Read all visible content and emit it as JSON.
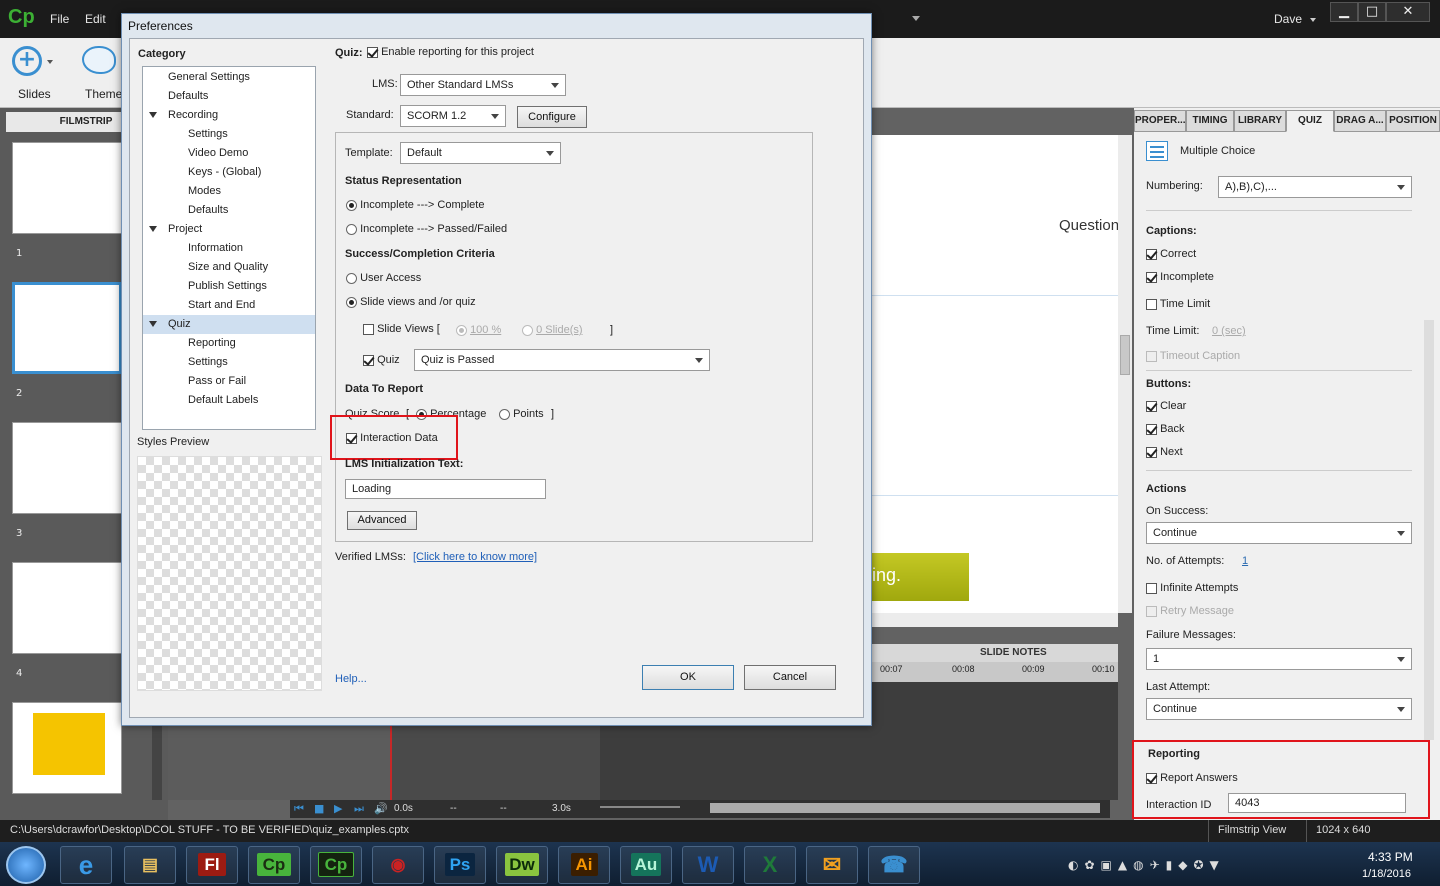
{
  "app": {
    "logo": "Cp",
    "menu": [
      "File",
      "Edit"
    ],
    "user": "Dave",
    "window_buttons": [
      "minimize",
      "maximize",
      "close"
    ]
  },
  "toolbar": {
    "slides_label": "Slides",
    "themes_label": "Themes"
  },
  "filmstrip": {
    "header": "FILMSTRIP",
    "slides": [
      "1",
      "2",
      "3",
      "4"
    ]
  },
  "stage": {
    "question_text": "Question",
    "banner_text": "ing.",
    "slide_notes": "SLIDE NOTES",
    "timeline_ticks": [
      "00:07",
      "00:08",
      "00:09",
      "00:10"
    ],
    "play_time": "0.0s",
    "duration": "3.0s",
    "dash1": "--",
    "dash2": "--"
  },
  "right_panel": {
    "tabs": [
      "PROPER...",
      "TIMING",
      "LIBRARY",
      "QUIZ",
      "DRAG A...",
      "POSITION"
    ],
    "question_type": "Multiple Choice",
    "numbering_label": "Numbering:",
    "numbering_value": "A),B),C),...",
    "captions_head": "Captions:",
    "captions": [
      {
        "label": "Correct",
        "checked": true
      },
      {
        "label": "Incomplete",
        "checked": true
      },
      {
        "label": "Time Limit",
        "checked": false
      }
    ],
    "time_limit_label": "Time Limit:",
    "time_limit_value": "0 (sec)",
    "timeout_caption": "Timeout Caption",
    "buttons_head": "Buttons:",
    "buttons": [
      {
        "label": "Clear",
        "checked": true
      },
      {
        "label": "Back",
        "checked": true
      },
      {
        "label": "Next",
        "checked": true
      }
    ],
    "actions_head": "Actions",
    "on_success_label": "On Success:",
    "on_success_value": "Continue",
    "attempts_label": "No. of Attempts:",
    "attempts_value": "1",
    "infinite_attempts": "Infinite Attempts",
    "retry_message": "Retry Message",
    "failure_messages_label": "Failure Messages:",
    "failure_messages_value": "1",
    "last_attempt_label": "Last Attempt:",
    "last_attempt_value": "Continue",
    "reporting_head": "Reporting",
    "report_answers": "Report Answers",
    "interaction_id_label": "Interaction ID",
    "interaction_id_value": "4043"
  },
  "status": {
    "path": "C:\\Users\\dcrawfor\\Desktop\\DCOL STUFF - TO BE VERIFIED\\quiz_examples.cptx",
    "view": "Filmstrip View",
    "resolution": "1024 x 640"
  },
  "taskbar": {
    "apps": [
      "Fl",
      "Cp",
      "Cp",
      "Ps",
      "Dw",
      "Ai",
      "Au",
      "W",
      "X"
    ],
    "time": "4:33 PM",
    "date": "1/18/2016"
  },
  "dialog": {
    "title": "Preferences",
    "category_head": "Category",
    "tree": [
      {
        "label": "General Settings",
        "level": 1,
        "expander": false
      },
      {
        "label": "Defaults",
        "level": 1,
        "expander": false
      },
      {
        "label": "Recording",
        "level": 1,
        "expander": true
      },
      {
        "label": "Settings",
        "level": 2,
        "expander": false
      },
      {
        "label": "Video Demo",
        "level": 2,
        "expander": false
      },
      {
        "label": "Keys - (Global)",
        "level": 2,
        "expander": false
      },
      {
        "label": "Modes",
        "level": 2,
        "expander": false
      },
      {
        "label": "Defaults",
        "level": 2,
        "expander": false
      },
      {
        "label": "Project",
        "level": 1,
        "expander": true
      },
      {
        "label": "Information",
        "level": 2,
        "expander": false
      },
      {
        "label": "Size and Quality",
        "level": 2,
        "expander": false
      },
      {
        "label": "Publish Settings",
        "level": 2,
        "expander": false
      },
      {
        "label": "Start and End",
        "level": 2,
        "expander": false
      },
      {
        "label": "Quiz",
        "level": 1,
        "expander": true,
        "selected": true
      },
      {
        "label": "Reporting",
        "level": 2,
        "expander": false
      },
      {
        "label": "Settings",
        "level": 2,
        "expander": false
      },
      {
        "label": "Pass or Fail",
        "level": 2,
        "expander": false
      },
      {
        "label": "Default Labels",
        "level": 2,
        "expander": false
      }
    ],
    "styles_preview": "Styles Preview",
    "quiz_label": "Quiz:",
    "enable_reporting": "Enable reporting for this project",
    "lms_label": "LMS:",
    "lms_value": "Other Standard LMSs",
    "standard_label": "Standard:",
    "standard_value": "SCORM 1.2",
    "configure": "Configure",
    "template_label": "Template:",
    "template_value": "Default",
    "status_rep_head": "Status Representation",
    "status_opt1": "Incomplete ---> Complete",
    "status_opt2": "Incomplete ---> Passed/Failed",
    "criteria_head": "Success/Completion Criteria",
    "user_access": "User Access",
    "slide_views_quiz": "Slide views and /or quiz",
    "slide_views": "Slide Views [",
    "pct_value": "100 %",
    "slides_value": "0 Slide(s)",
    "bracket_close": "]",
    "quiz_check": "Quiz",
    "quiz_passed": "Quiz is Passed",
    "data_head": "Data To Report",
    "quiz_score": "Quiz Score",
    "score_bracket": "[",
    "percentage": "Percentage",
    "points": "Points",
    "points_bracket": "]",
    "interaction_data": "Interaction Data",
    "lms_init_head": "LMS Initialization Text:",
    "lms_init_value": "Loading",
    "advanced": "Advanced",
    "verified_label": "Verified LMSs:",
    "verified_link": "[Click here to know more]",
    "help": "Help...",
    "ok": "OK",
    "cancel": "Cancel"
  }
}
